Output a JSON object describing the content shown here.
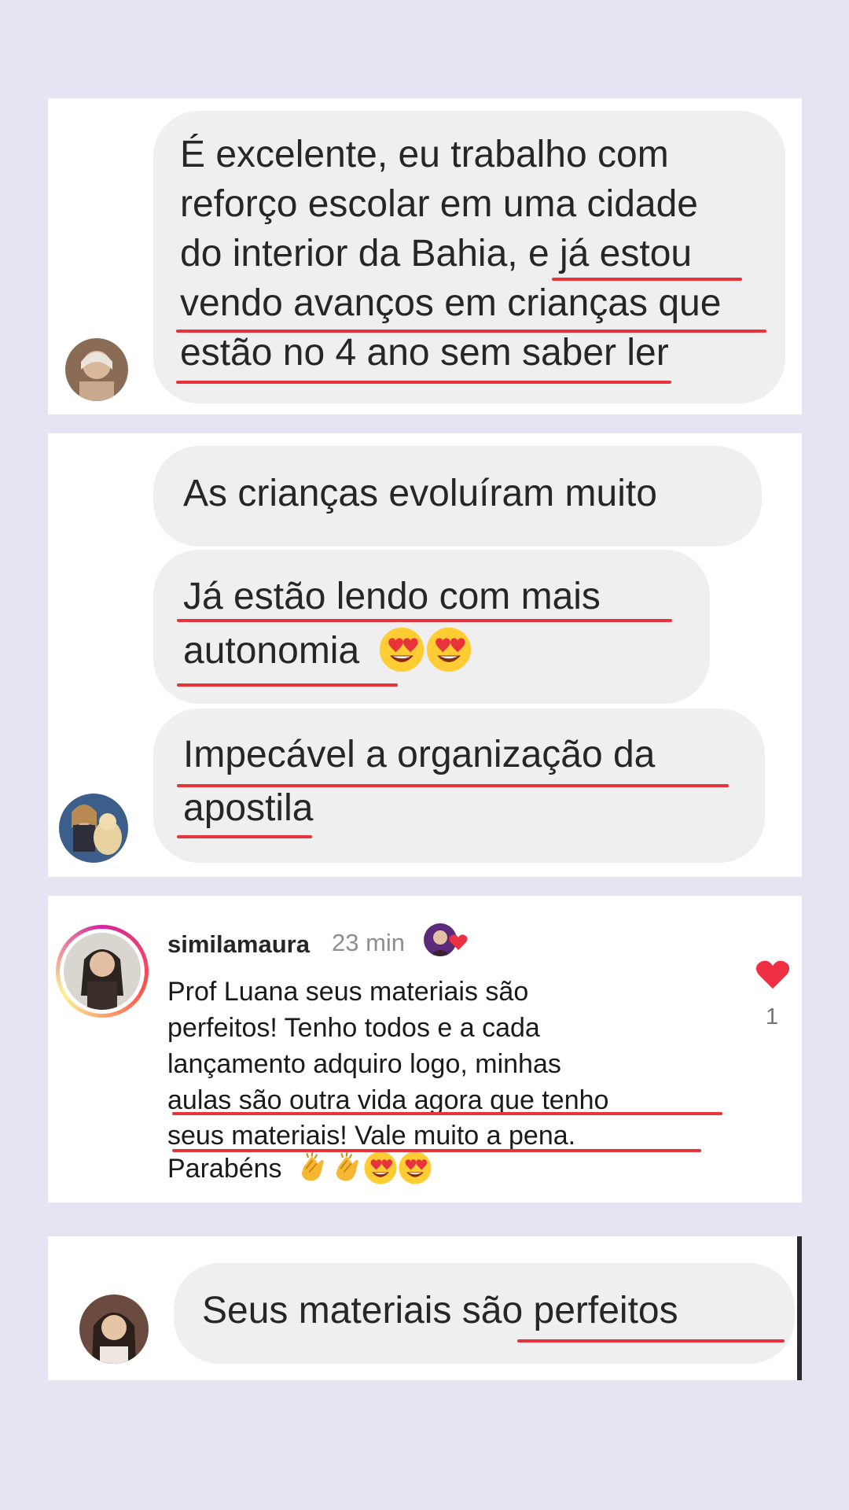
{
  "card1": {
    "lines": [
      "É excelente,  eu trabalho com",
      "reforço escolar em uma cidade",
      "do interior da Bahia,  e já estou",
      "vendo avanços em crianças que",
      "estão no 4 ano sem saber ler"
    ]
  },
  "card2": {
    "msg1": "As crianças evoluíram muito",
    "msg2_line1": "Já estão lendo com mais",
    "msg2_line2": "autonomia",
    "msg3_line1": "Impecável a organização da",
    "msg3_line2": "apostila"
  },
  "card3": {
    "username": "similamaura",
    "time": "23 min",
    "lines": [
      "Prof Luana seus materiais são",
      "perfeitos! Tenho todos e a cada",
      "lançamento adquiro logo, minhas",
      "aulas são outra vida agora que tenho",
      "seus materiais! Vale muito a pena.",
      "Parabéns"
    ],
    "like_count": "1"
  },
  "card4": {
    "message": "Seus materiais  são  perfeitos"
  },
  "colors": {
    "background": "#e6e3f3",
    "bubble": "#efefef",
    "underline": "#e8333b",
    "heart": "#ed2f41"
  },
  "icons": [
    "heart-eyes-emoji",
    "clapping-hands-emoji",
    "heart-icon"
  ]
}
